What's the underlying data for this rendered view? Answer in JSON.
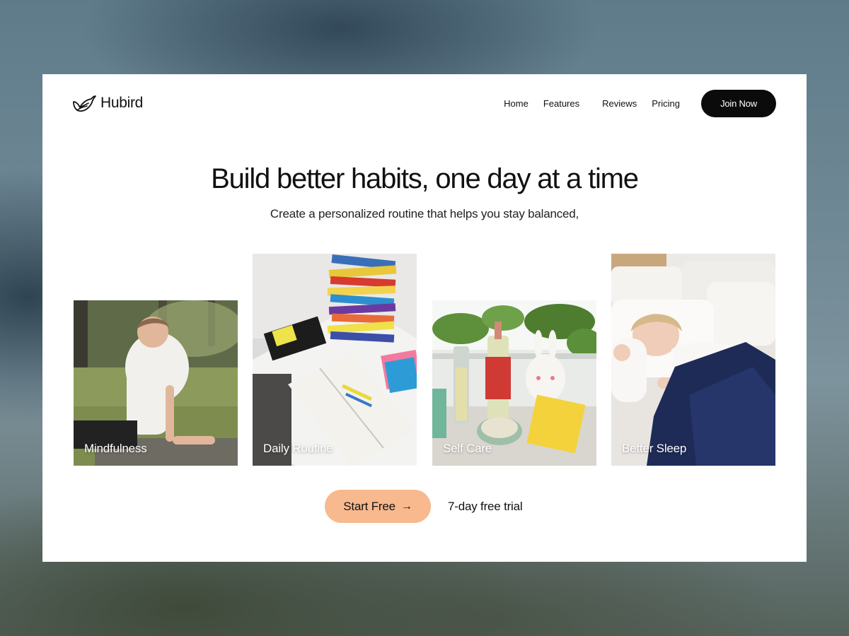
{
  "brand": {
    "name": "Hubird",
    "logo_icon": "bird-logo-icon"
  },
  "nav": {
    "items": [
      {
        "label": "Home"
      },
      {
        "label": "Features"
      },
      {
        "label": "Reviews"
      },
      {
        "label": "Pricing"
      }
    ],
    "cta_label": "Join Now"
  },
  "hero": {
    "title": "Build better habits, one day at a time",
    "subtitle": "Create a personalized routine that helps you stay balanced,"
  },
  "categories": [
    {
      "label": "Mindfulness",
      "image": "man-stretching-on-grass-photo"
    },
    {
      "label": "Daily Routine",
      "image": "stack-of-books-on-desk-photo"
    },
    {
      "label": "Self Care",
      "image": "self-care-products-on-windowsill-photo"
    },
    {
      "label": "Better Sleep",
      "image": "woman-sleeping-in-bed-photo"
    }
  ],
  "cta": {
    "primary_label": "Start Free",
    "primary_icon": "arrow-right-icon",
    "note": "7-day free trial"
  },
  "colors": {
    "accent": "#f8b98e",
    "dark_button": "#0b0b0b",
    "card_background": "#ffffff"
  }
}
